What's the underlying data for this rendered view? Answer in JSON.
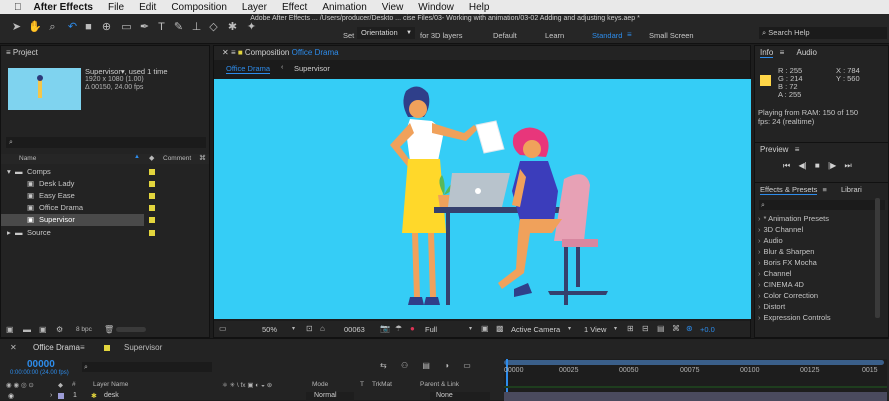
{
  "menubar": {
    "apple": "",
    "app_name": "After Effects",
    "items": [
      "File",
      "Edit",
      "Composition",
      "Layer",
      "Effect",
      "Animation",
      "View",
      "Window",
      "Help"
    ]
  },
  "window_title": "Adobe After Effects ... /Users/producer/Deskto ... cise Files/03- Working with animation/03-02 Adding and adjusting keys.aep *",
  "toolbar": {
    "set_label": "Set",
    "orientation": "Orientation",
    "for_3d": "for 3D layers",
    "workspaces": [
      "Default",
      "Learn",
      "Standard",
      "Small Screen"
    ],
    "search_help": "Search Help"
  },
  "project": {
    "title": "Project",
    "selected_name": "Supervisor",
    "used_count": ", used 1 time",
    "resolution": "1920 x 1080 (1.00)",
    "duration": "Δ 00150, 24.00 fps",
    "col_name": "Name",
    "col_comment": "Comment",
    "bpc": "8 bpc",
    "tree": [
      {
        "name": "Comps",
        "type": "folder",
        "indent": 0
      },
      {
        "name": "Desk Lady",
        "type": "comp",
        "indent": 1
      },
      {
        "name": "Easy Ease",
        "type": "comp",
        "indent": 1
      },
      {
        "name": "Office Drama",
        "type": "comp",
        "indent": 1
      },
      {
        "name": "Supervisor",
        "type": "comp",
        "indent": 1,
        "selected": true
      },
      {
        "name": "Source",
        "type": "folder",
        "indent": 0
      }
    ]
  },
  "composition": {
    "title_prefix": "Composition",
    "title_name": "Office Drama",
    "tabs": [
      "Office Drama",
      "Supervisor"
    ],
    "zoom": "50%",
    "timecode": "00063",
    "resolution": "Full",
    "camera": "Active Camera",
    "view": "1 View",
    "exposure": "+0.0"
  },
  "info": {
    "tab_info": "Info",
    "tab_audio": "Audio",
    "r": "R : 255",
    "g": "G : 214",
    "b": "B : 72",
    "a": "A : 255",
    "x": "X : 784",
    "y": "Y : 560",
    "playing": "Playing from RAM: 150 of 150",
    "fps": "fps: 24 (realtime)",
    "swatch_color": "#ffd648"
  },
  "preview": {
    "title": "Preview"
  },
  "effects": {
    "title": "Effects & Presets",
    "tab_libraries": "Librari",
    "items": [
      "* Animation Presets",
      "3D Channel",
      "Audio",
      "Blur & Sharpen",
      "Boris FX Mocha",
      "Channel",
      "CINEMA 4D",
      "Color Correction",
      "Distort",
      "Expression Controls"
    ]
  },
  "timeline": {
    "tabs": [
      "Office Drama",
      "Supervisor"
    ],
    "timecode": "00000",
    "timecode_sub": "0:00:00:00 (24.00 fps)",
    "cols": {
      "layer_name": "Layer Name",
      "mode": "Mode",
      "t": "T",
      "trkmat": "TrkMat",
      "parent": "Parent & Link"
    },
    "layer": {
      "index": "1",
      "name": "desk",
      "mode": "Normal",
      "parent": "None"
    },
    "ruler": [
      "00000",
      "00025",
      "00050",
      "00075",
      "00100",
      "00125",
      "0015"
    ]
  },
  "colors": {
    "canvas_bg": "#35cdf6",
    "accent_blue": "#2d8ceb",
    "label_yellow": "#e3d53d"
  }
}
